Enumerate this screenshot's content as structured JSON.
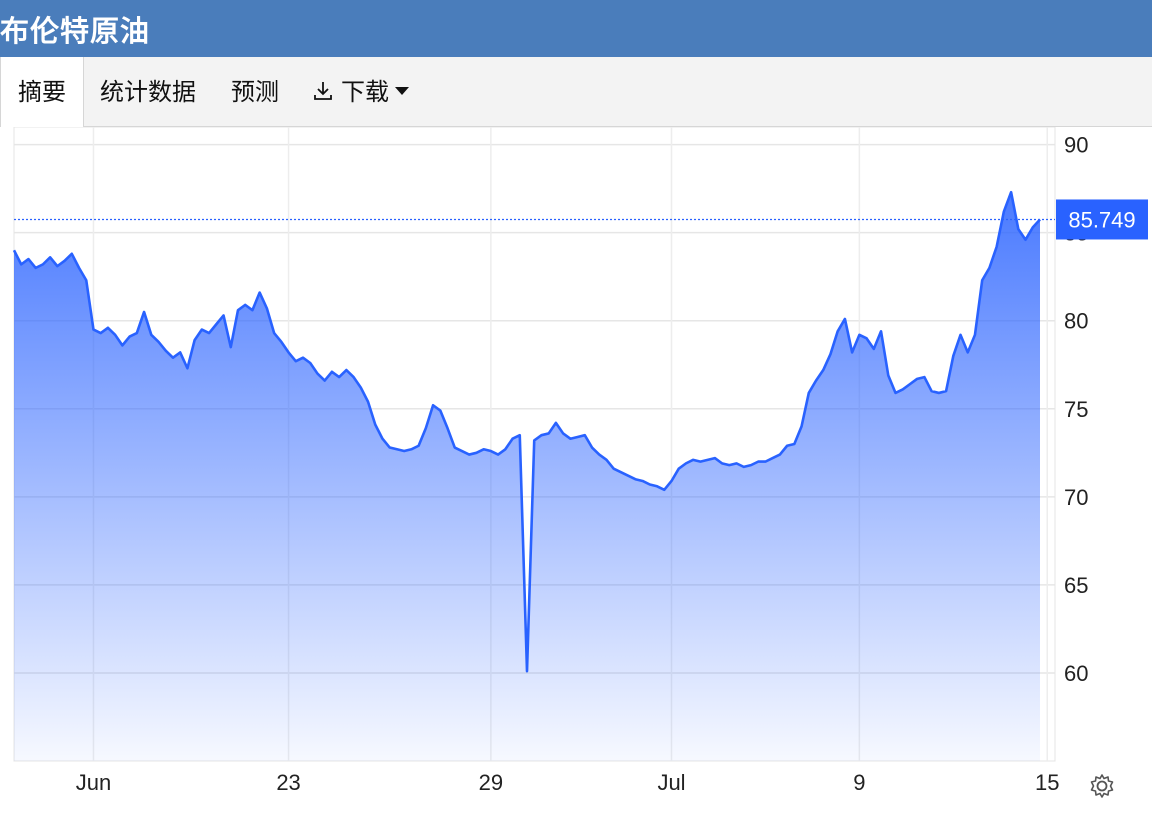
{
  "header": {
    "title": "布伦特原油"
  },
  "tabs": {
    "summary": "摘要",
    "stats": "统计数据",
    "forecast": "预测",
    "download": "下载"
  },
  "icons": {
    "download": "download-icon",
    "caret": "caret-down-icon",
    "settings": "gear-icon"
  },
  "colors": {
    "header": "#4a7dbb",
    "line": "#2962ff",
    "badge": "#2962ff"
  },
  "chart_data": {
    "type": "area",
    "title": "",
    "xlabel": "",
    "ylabel": "",
    "ylim": [
      55,
      91
    ],
    "y_ticks": [
      60,
      65,
      70,
      75,
      80,
      85,
      90
    ],
    "y_tick_labels": [
      "60",
      "65",
      "70",
      "75",
      "80",
      "85",
      "90"
    ],
    "x_tick_labels": [
      "Jun",
      "23",
      "29",
      "Jul",
      "9",
      "15"
    ],
    "x_tick_index": [
      11,
      38,
      66,
      91,
      117,
      143
    ],
    "last_value_label": "85.749",
    "last_value": 85.749,
    "grid": true,
    "series": [
      {
        "values": [
          84,
          83.2,
          83.5,
          83,
          83.2,
          83.6,
          83.1,
          83.4,
          83.8,
          83,
          82.3,
          79.5,
          79.3,
          79.6,
          79.2,
          78.6,
          79.1,
          79.3,
          80.5,
          79.2,
          78.8,
          78.3,
          77.9,
          78.2,
          77.3,
          78.9,
          79.5,
          79.3,
          79.8,
          80.3,
          78.5,
          80.6,
          80.9,
          80.6,
          81.6,
          80.7,
          79.3,
          78.8,
          78.2,
          77.7,
          77.9,
          77.6,
          77,
          76.6,
          77.1,
          76.8,
          77.2,
          76.8,
          76.2,
          75.4,
          74.1,
          73.3,
          72.8,
          72.7,
          72.6,
          72.7,
          72.9,
          73.9,
          75.2,
          74.9,
          73.9,
          72.8,
          72.6,
          72.4,
          72.5,
          72.7,
          72.6,
          72.4,
          72.7,
          73.3,
          73.5,
          60.1,
          73.2,
          73.5,
          73.6,
          74.2,
          73.6,
          73.3,
          73.4,
          73.5,
          72.8,
          72.4,
          72.1,
          71.6,
          71.4,
          71.2,
          71,
          70.9,
          70.7,
          70.6,
          70.4,
          70.9,
          71.6,
          71.9,
          72.1,
          72,
          72.1,
          72.2,
          71.9,
          71.8,
          71.9,
          71.7,
          71.8,
          72,
          72,
          72.2,
          72.4,
          72.9,
          73,
          74,
          75.9,
          76.6,
          77.2,
          78.1,
          79.4,
          80.1,
          78.2,
          79.2,
          79,
          78.4,
          79.4,
          76.9,
          75.9,
          76.1,
          76.4,
          76.7,
          76.8,
          76,
          75.9,
          76,
          78,
          79.2,
          78.2,
          79.2,
          82.3,
          83,
          84.2,
          86.2,
          87.3,
          85.2,
          84.6,
          85.3,
          85.749
        ]
      }
    ]
  }
}
